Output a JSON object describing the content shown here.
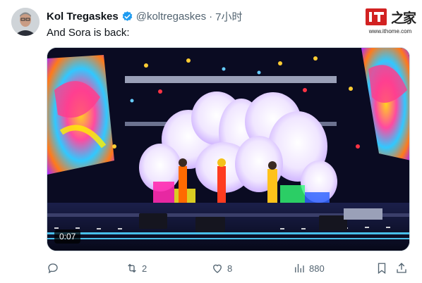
{
  "author": {
    "name": "Kol Tregaskes",
    "handle": "@koltregaskes",
    "separator": "·",
    "time": "7小时"
  },
  "tweet": {
    "text": "And Sora is back:"
  },
  "media": {
    "duration": "0:07"
  },
  "actions": {
    "reply_count": "",
    "retweet_count": "2",
    "like_count": "8",
    "views_count": "880"
  },
  "watermark": {
    "url": "www.ithome.com"
  },
  "icons": {
    "verified": "verified-badge-icon",
    "reply": "reply-icon",
    "retweet": "retweet-icon",
    "like": "heart-icon",
    "views": "views-chart-icon",
    "bookmark": "bookmark-icon",
    "share": "share-icon"
  },
  "colors": {
    "verified_blue": "#1d9bf0",
    "meta_gray": "#536471",
    "watermark_red": "#d22222"
  }
}
